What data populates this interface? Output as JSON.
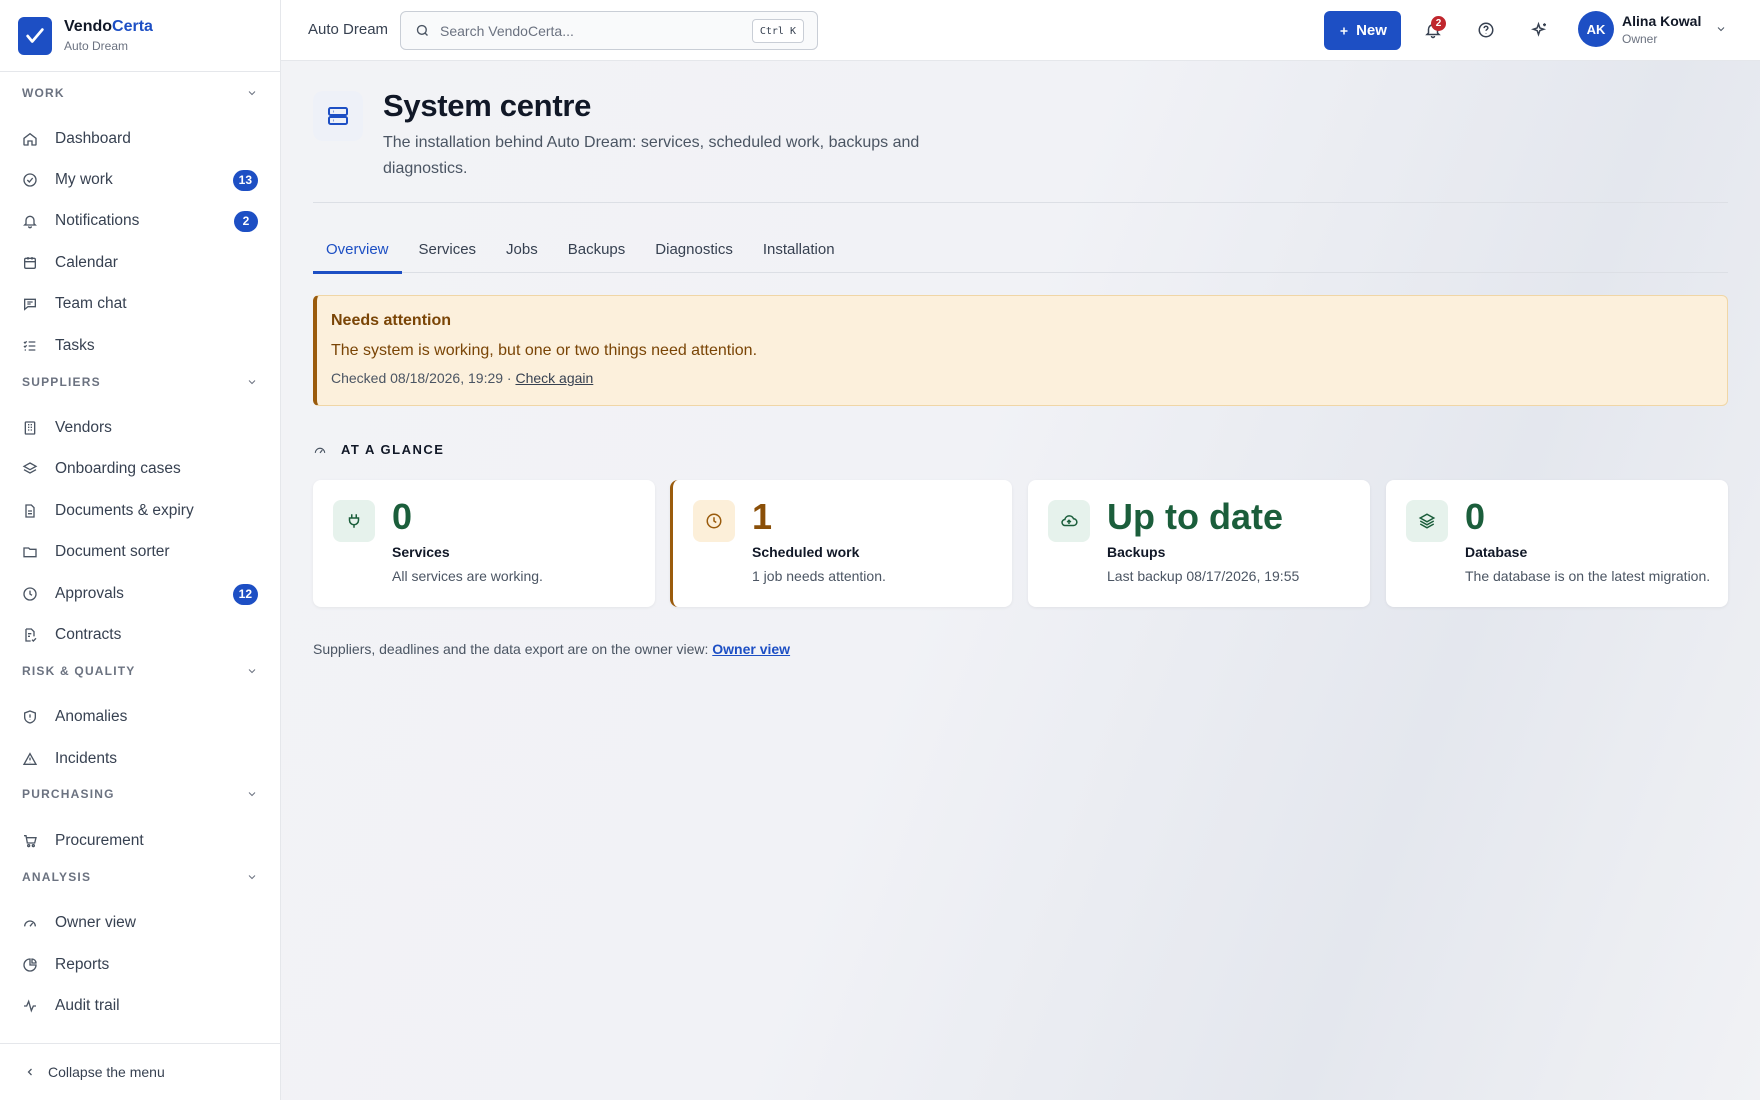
{
  "brand": {
    "name_prefix": "Vendo",
    "name_accent": "Certa",
    "org": "Auto Dream"
  },
  "sidebar": {
    "sections": [
      {
        "title": "WORK",
        "items": [
          {
            "label": "Dashboard",
            "icon": "home-icon"
          },
          {
            "label": "My work",
            "icon": "check-circle-icon",
            "badge": "13"
          },
          {
            "label": "Notifications",
            "icon": "bell-icon",
            "badge": "2"
          },
          {
            "label": "Calendar",
            "icon": "calendar-icon"
          },
          {
            "label": "Team chat",
            "icon": "chat-icon"
          },
          {
            "label": "Tasks",
            "icon": "list-check-icon"
          }
        ]
      },
      {
        "title": "SUPPLIERS",
        "items": [
          {
            "label": "Vendors",
            "icon": "building-icon"
          },
          {
            "label": "Onboarding cases",
            "icon": "layers-icon"
          },
          {
            "label": "Documents & expiry",
            "icon": "document-icon"
          },
          {
            "label": "Document sorter",
            "icon": "folder-icon"
          },
          {
            "label": "Approvals",
            "icon": "clock-icon",
            "badge": "12"
          },
          {
            "label": "Contracts",
            "icon": "contract-icon"
          }
        ]
      },
      {
        "title": "RISK & QUALITY",
        "items": [
          {
            "label": "Anomalies",
            "icon": "shield-icon"
          },
          {
            "label": "Incidents",
            "icon": "warning-icon"
          }
        ]
      },
      {
        "title": "PURCHASING",
        "items": [
          {
            "label": "Procurement",
            "icon": "cart-icon"
          }
        ]
      },
      {
        "title": "ANALYSIS",
        "items": [
          {
            "label": "Owner view",
            "icon": "gauge-icon"
          },
          {
            "label": "Reports",
            "icon": "pie-chart-icon"
          },
          {
            "label": "Audit trail",
            "icon": "activity-icon"
          }
        ]
      }
    ],
    "collapse_label": "Collapse the menu"
  },
  "topbar": {
    "org": "Auto Dream",
    "search_placeholder": "Search VendoCerta...",
    "shortcut": "Ctrl K",
    "new_label": "New",
    "notification_count": "2",
    "user": {
      "initials": "AK",
      "name": "Alina Kowal",
      "role": "Owner"
    }
  },
  "page": {
    "title": "System centre",
    "description": "The installation behind Auto Dream: services, scheduled work, backups and diagnostics.",
    "tabs": [
      "Overview",
      "Services",
      "Jobs",
      "Backups",
      "Diagnostics",
      "Installation"
    ],
    "alert": {
      "title": "Needs attention",
      "text": "The system is working, but one or two things need attention.",
      "checked": "Checked 08/18/2026, 19:29 · ",
      "action": "Check again"
    },
    "glance_title": "AT A GLANCE",
    "cards": [
      {
        "value": "0",
        "label": "Services",
        "sub": "All services are working.",
        "icon": "plug-icon"
      },
      {
        "value": "1",
        "label": "Scheduled work",
        "sub": "1 job needs attention.",
        "icon": "clock-icon"
      },
      {
        "value": "Up to date",
        "label": "Backups",
        "sub": "Last backup 08/17/2026, 19:55",
        "icon": "cloud-upload-icon"
      },
      {
        "value": "0",
        "label": "Database",
        "sub": "The database is on the latest migration.",
        "icon": "layers-icon"
      }
    ],
    "footnote": "Suppliers, deadlines and the data export are on the owner view: ",
    "footnote_link": "Owner view"
  },
  "colors": {
    "accent": "#1d4fc4",
    "success": "#1b5e3b",
    "warning": "#9a5b0c",
    "danger": "#c0262d"
  }
}
